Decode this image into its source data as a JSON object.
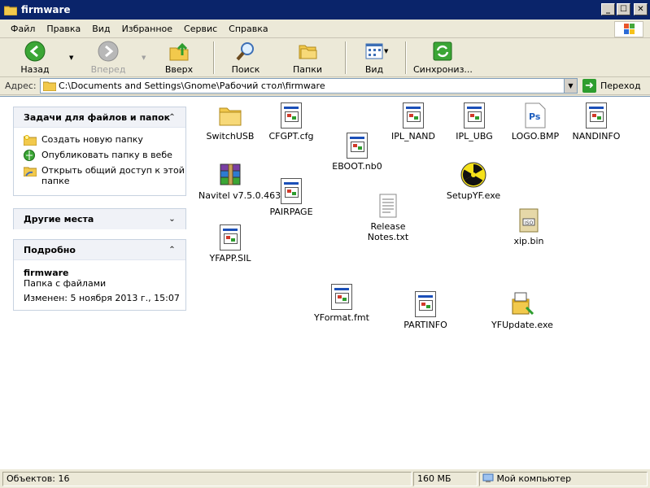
{
  "window": {
    "title": "firmware"
  },
  "menu": [
    "Файл",
    "Правка",
    "Вид",
    "Избранное",
    "Сервис",
    "Справка"
  ],
  "toolbar": {
    "back_label": "Назад",
    "forward_label": "Вперед",
    "up_label": "Вверх",
    "search_label": "Поиск",
    "folders_label": "Папки",
    "view_label": "Вид",
    "sync_label": "Синхрониз..."
  },
  "address": {
    "label": "Адрес:",
    "value": "C:\\Documents and Settings\\Gnome\\Рабочий стол\\firmware",
    "go_label": "Переход"
  },
  "tasks": {
    "title": "Задачи для файлов и папок",
    "items": [
      "Создать новую папку",
      "Опубликовать папку в вебе",
      "Открыть общий доступ к этой папке"
    ]
  },
  "other_places": {
    "title": "Другие места"
  },
  "details": {
    "title": "Подробно",
    "name": "firmware",
    "type": "Папка с файлами",
    "modified": "Изменен: 5 ноября 2013 г., 15:07"
  },
  "files": [
    {
      "name": "SwitchUSB",
      "icon": "folder-icon"
    },
    {
      "name": "CFGPT.cfg",
      "icon": "generic-file-icon"
    },
    {
      "name": "EBOOT.nb0",
      "icon": "generic-file-icon"
    },
    {
      "name": "IPL_NAND",
      "icon": "generic-file-icon"
    },
    {
      "name": "IPL_UBG",
      "icon": "generic-file-icon"
    },
    {
      "name": "LOGO.BMP",
      "icon": "photoshop-file-icon"
    },
    {
      "name": "NANDINFO",
      "icon": "generic-file-icon"
    },
    {
      "name": "Navitel v7.5.0.463...",
      "icon": "winrar-archive-icon"
    },
    {
      "name": "PAIRPAGE",
      "icon": "generic-file-icon"
    },
    {
      "name": "Release Notes.txt",
      "icon": "text-file-icon"
    },
    {
      "name": "SetupYF.exe",
      "icon": "radiation-exe-icon"
    },
    {
      "name": "xip.bin",
      "icon": "bin-file-icon"
    },
    {
      "name": "YFAPP.SIL",
      "icon": "generic-file-icon"
    },
    {
      "name": "YFormat.fmt",
      "icon": "generic-file-icon"
    },
    {
      "name": "PARTINFO",
      "icon": "generic-file-icon"
    },
    {
      "name": "YFUpdate.exe",
      "icon": "installer-exe-icon"
    }
  ],
  "status": {
    "objects": "Объектов: 16",
    "size": "160 МБ",
    "location": "Мой компьютер"
  }
}
